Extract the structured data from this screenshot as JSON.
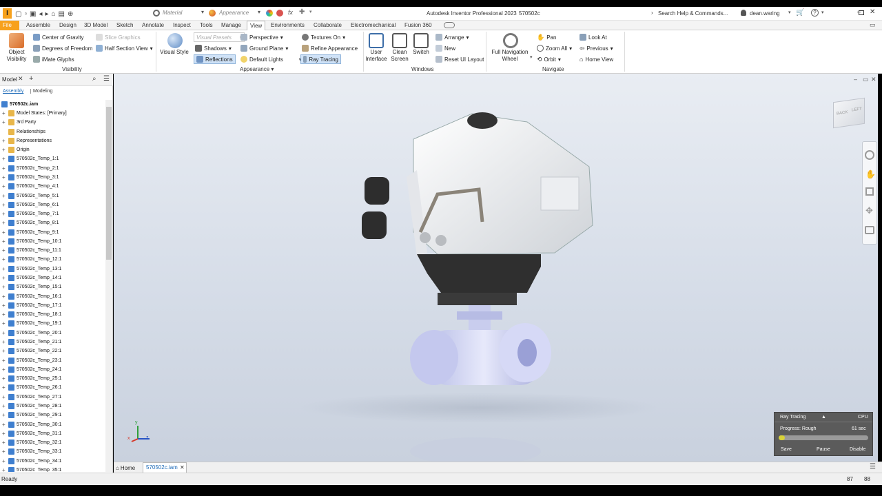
{
  "titlebar": {
    "app_title": "Autodesk Inventor Professional 2023",
    "doc_name": "570502c",
    "material_placeholder": "Material",
    "appearance_placeholder": "Appearance",
    "search_label": "Search Help & Commands...",
    "user_name": "dean.waring",
    "fx_label": "fx"
  },
  "tabs": [
    "File",
    "Assemble",
    "Design",
    "3D Model",
    "Sketch",
    "Annotate",
    "Inspect",
    "Tools",
    "Manage",
    "View",
    "Environments",
    "Collaborate",
    "Electromechanical",
    "Fusion 360"
  ],
  "active_tab": "View",
  "ribbon": {
    "visibility": {
      "label": "Visibility",
      "object_visibility": "Object Visibility",
      "center_of_gravity": "Center of Gravity",
      "degrees_of_freedom": "Degrees of Freedom",
      "imate_glyphs": "iMate Glyphs",
      "slice_graphics": "Slice Graphics",
      "half_section_view": "Half Section View"
    },
    "appearance": {
      "label": "Appearance",
      "visual_style": "Visual Style",
      "visual_presets": "Visual Presets",
      "perspective": "Perspective",
      "textures_on": "Textures On",
      "shadows": "Shadows",
      "ground_plane": "Ground Plane",
      "refine_appearance": "Refine Appearance",
      "reflections": "Reflections",
      "default_lights": "Default Lights",
      "ray_tracing": "Ray Tracing"
    },
    "windows": {
      "label": "Windows",
      "user_interface": "User Interface",
      "clean_screen": "Clean Screen",
      "switch": "Switch",
      "arrange": "Arrange",
      "new": "New",
      "reset_ui_layout": "Reset UI Layout"
    },
    "navigate": {
      "label": "Navigate",
      "full_navigation_wheel": "Full Navigation Wheel",
      "pan": "Pan",
      "zoom_all": "Zoom All",
      "orbit": "Orbit",
      "look_at": "Look At",
      "previous": "Previous",
      "home_view": "Home View"
    }
  },
  "browser": {
    "title": "Model",
    "tab_assembly": "Assembly",
    "tab_modeling": "Modeling",
    "root": "570502c.iam",
    "items": [
      "Model States: [Primary]",
      "3rd Party",
      "Relationships",
      "Representations",
      "Origin",
      "570502c_Temp_1:1",
      "570502c_Temp_2:1",
      "570502c_Temp_3:1",
      "570502c_Temp_4:1",
      "570502c_Temp_5:1",
      "570502c_Temp_6:1",
      "570502c_Temp_7:1",
      "570502c_Temp_8:1",
      "570502c_Temp_9:1",
      "570502c_Temp_10:1",
      "570502c_Temp_11:1",
      "570502c_Temp_12:1",
      "570502c_Temp_13:1",
      "570502c_Temp_14:1",
      "570502c_Temp_15:1",
      "570502c_Temp_16:1",
      "570502c_Temp_17:1",
      "570502c_Temp_18:1",
      "570502c_Temp_19:1",
      "570502c_Temp_20:1",
      "570502c_Temp_21:1",
      "570502c_Temp_22:1",
      "570502c_Temp_23:1",
      "570502c_Temp_24:1",
      "570502c_Temp_25:1",
      "570502c_Temp_26:1",
      "570502c_Temp_27:1",
      "570502c_Temp_28:1",
      "570502c_Temp_29:1",
      "570502c_Temp_30:1",
      "570502c_Temp_31:1",
      "570502c_Temp_32:1",
      "570502c_Temp_33:1",
      "570502c_Temp_34:1",
      "570502c_Temp_35:1"
    ]
  },
  "viewcube": {
    "back": "BACK",
    "left": "LEFT"
  },
  "triad": {
    "x": "x",
    "y": "y",
    "z": "z"
  },
  "raytracing": {
    "title": "Ray Tracing",
    "device": "CPU",
    "progress_label": "Progress: Rough",
    "time": "61 sec",
    "progress_fraction": 0.07,
    "save": "Save",
    "pause": "Pause",
    "disable": "Disable"
  },
  "docbar": {
    "home": "Home",
    "doc_tab": "570502c.iam"
  },
  "status": {
    "text": "Ready",
    "count1": "87",
    "count2": "88"
  },
  "colors": {
    "file_tab": "#f7a11c",
    "accent": "#1e6bb8",
    "folder": "#e8b64a",
    "part": "#3f7fcf"
  }
}
